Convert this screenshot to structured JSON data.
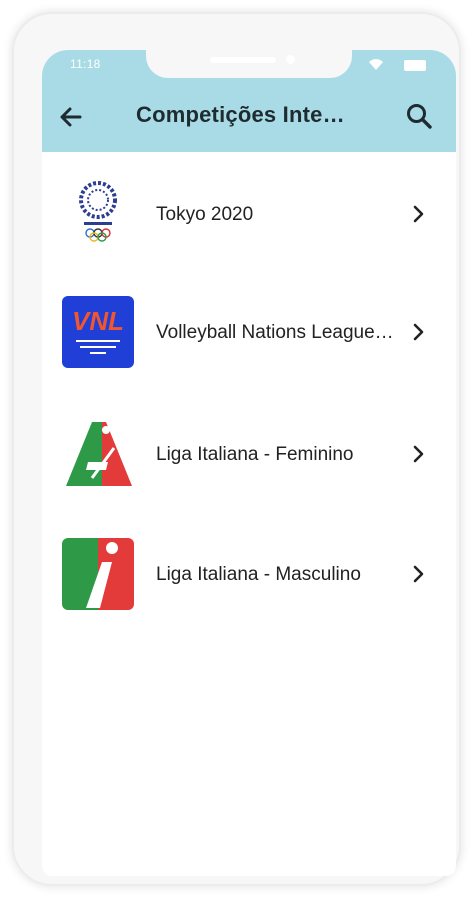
{
  "status_bar": {
    "time": "11:18"
  },
  "header": {
    "title": "Competições Inte…",
    "back_icon": "arrow-left-icon",
    "search_icon": "search-icon"
  },
  "competitions": [
    {
      "label": "Tokyo 2020",
      "logo": "tokyo-2020-logo"
    },
    {
      "label": "Volleyball Nations League…",
      "logo": "vnl-logo",
      "logo_text": "VNL"
    },
    {
      "label": "Liga Italiana - Feminino",
      "logo": "liga-italiana-feminino-logo"
    },
    {
      "label": "Liga Italiana - Masculino",
      "logo": "liga-italiana-masculino-logo"
    }
  ],
  "colors": {
    "app_bar": "#a9dbe7",
    "title_text": "#1e2b30",
    "vnl_blue": "#1f3fd6",
    "italy_green": "#2e9a48",
    "italy_red": "#e33a3a"
  }
}
